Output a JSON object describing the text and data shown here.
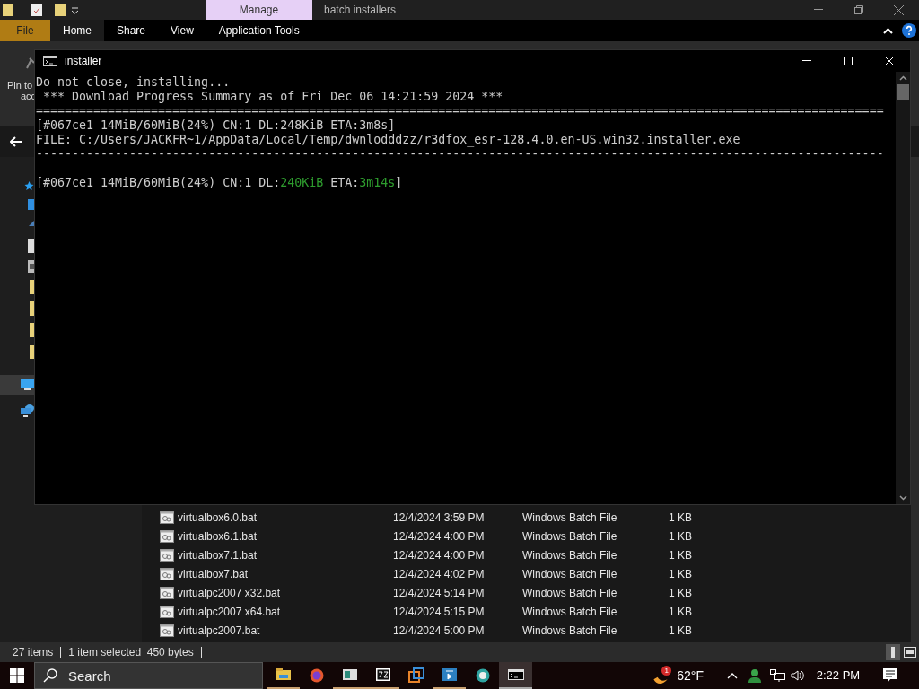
{
  "explorer": {
    "context_tab": "Manage",
    "title": "batch installers",
    "ribbon_tabs": [
      {
        "label": "File",
        "kind": "file",
        "selected": false
      },
      {
        "label": "Home",
        "kind": "tab",
        "selected": true
      },
      {
        "label": "Share",
        "kind": "tab",
        "selected": false
      },
      {
        "label": "View",
        "kind": "tab",
        "selected": false
      },
      {
        "label": "Application Tools",
        "kind": "tab",
        "selected": false
      }
    ],
    "ribbon_texts": [
      "Pin to",
      "acc"
    ],
    "files": [
      {
        "name": "virtualbox6.0.bat",
        "date": "12/4/2024 3:59 PM",
        "type": "Windows Batch File",
        "size": "1 KB"
      },
      {
        "name": "virtualbox6.1.bat",
        "date": "12/4/2024 4:00 PM",
        "type": "Windows Batch File",
        "size": "1 KB"
      },
      {
        "name": "virtualbox7.1.bat",
        "date": "12/4/2024 4:00 PM",
        "type": "Windows Batch File",
        "size": "1 KB"
      },
      {
        "name": "virtualbox7.bat",
        "date": "12/4/2024 4:02 PM",
        "type": "Windows Batch File",
        "size": "1 KB"
      },
      {
        "name": "virtualpc2007 x32.bat",
        "date": "12/4/2024 5:14 PM",
        "type": "Windows Batch File",
        "size": "1 KB"
      },
      {
        "name": "virtualpc2007 x64.bat",
        "date": "12/4/2024 5:15 PM",
        "type": "Windows Batch File",
        "size": "1 KB"
      },
      {
        "name": "virtualpc2007.bat",
        "date": "12/4/2024 5:00 PM",
        "type": "Windows Batch File",
        "size": "1 KB"
      }
    ],
    "status_bar": {
      "item_count": "27 items",
      "selection": "1 item selected  450 bytes"
    }
  },
  "console": {
    "title": "installer",
    "lines": [
      {
        "segments": [
          {
            "text": "Do not close, installing...",
            "color": "#cccccc"
          }
        ]
      },
      {
        "segments": [
          {
            "text": " *** Download Progress Summary as of Fri Dec 06 14:21:59 2024 ***",
            "color": "#cccccc"
          }
        ]
      },
      {
        "segments": [
          {
            "text": "======================================================================================================================",
            "color": "#cccccc"
          }
        ]
      },
      {
        "segments": [
          {
            "text": "[#067ce1 14MiB/60MiB(24%) CN:1 DL:248KiB ETA:3m8s]",
            "color": "#cccccc"
          }
        ]
      },
      {
        "segments": [
          {
            "text": "FILE: C:/Users/JACKFR~1/AppData/Local/Temp/dwnlodddzz/r3dfox_esr-128.4.0.en-US.win32.installer.exe",
            "color": "#cccccc"
          }
        ]
      },
      {
        "segments": [
          {
            "text": "----------------------------------------------------------------------------------------------------------------------",
            "color": "#cccccc"
          }
        ]
      },
      {
        "kind": "blank"
      },
      {
        "segments": [
          {
            "text": "[#067ce1 14MiB/60MiB(24%) CN:1 DL:",
            "color": "#cccccc"
          },
          {
            "text": "240KiB",
            "color": "#2e9d2e"
          },
          {
            "text": " ETA:",
            "color": "#cccccc"
          },
          {
            "text": "3m14s",
            "color": "#2e9d2e"
          },
          {
            "text": "]",
            "color": "#cccccc"
          }
        ]
      }
    ]
  },
  "taskbar": {
    "search_placeholder": "Search",
    "weather_badge": "1",
    "temperature": "62°F",
    "time": "2:22 PM"
  }
}
